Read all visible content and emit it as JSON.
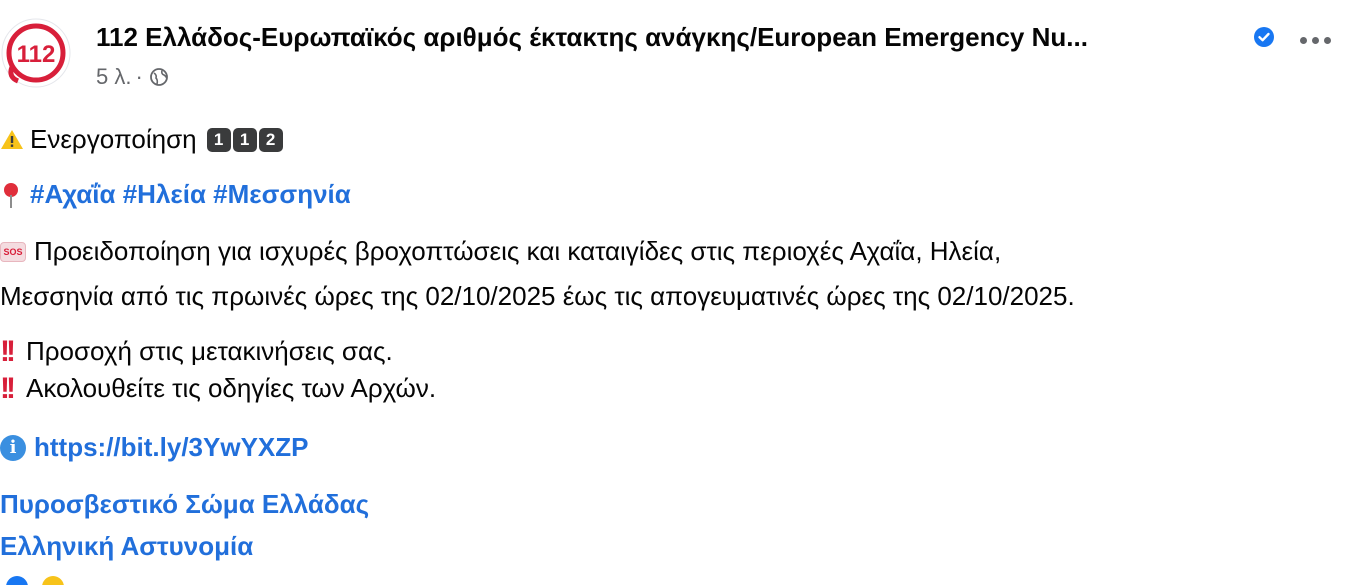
{
  "post": {
    "avatar_text": "112",
    "author": "112 Ελλάδος-Ευρωπαϊκός αριθμός έκτακτης ανάγκης/European Emergency Nu...",
    "time": "5 λ.",
    "separator": "·"
  },
  "body": {
    "activation_text": "Ενεργοποίηση",
    "keycaps": [
      "1",
      "1",
      "2"
    ],
    "hashtags": "#Αχαΐα #Ηλεία #Μεσσηνία",
    "sos_badge": "SOS",
    "warning_line1": "Προειδοποίηση για ισχυρές βροχοπτώσεις και καταιγίδες στις περιοχές Αχαΐα, Ηλεία,",
    "warning_line2": "Μεσσηνία από τις πρωινές ώρες της 02/10/2025 έως τις απογευματινές ώρες της 02/10/2025.",
    "caution1": "Προσοχή στις μετακινήσεις σας.",
    "caution2": "Ακολουθείτε τις οδηγίες των Αρχών.",
    "bang": "!!",
    "info_glyph": "i",
    "url": "https://bit.ly/3YwYXZP",
    "mention1": "Πυροσβεστικό Σώμα Ελλάδας",
    "mention2": "Ελληνική Αστυνομία"
  },
  "colors": {
    "link": "#216fdb",
    "text": "#050505",
    "muted": "#65676b",
    "alert_red": "#d81f3a",
    "verified_blue": "#1877f2"
  }
}
